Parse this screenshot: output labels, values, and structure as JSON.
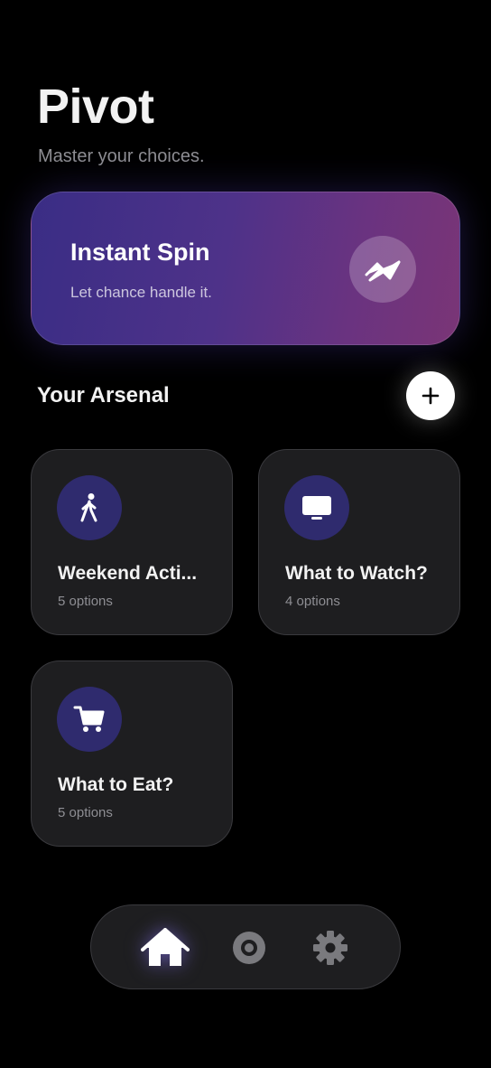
{
  "app": {
    "title": "Pivot",
    "subtitle": "Master your choices."
  },
  "instant_spin": {
    "title": "Instant Spin",
    "subtitle": "Let chance handle it.",
    "icon": "squiggle-wave-icon"
  },
  "arsenal": {
    "title": "Your Arsenal",
    "add_icon": "plus-icon",
    "cards": [
      {
        "title": "Weekend Acti...",
        "count": "5 options",
        "icon": "walking-person-icon"
      },
      {
        "title": "What to Watch?",
        "count": "4 options",
        "icon": "tv-icon"
      },
      {
        "title": "What to Eat?",
        "count": "5 options",
        "icon": "shopping-cart-icon"
      }
    ]
  },
  "tabbar": {
    "items": [
      {
        "name": "home",
        "icon": "home-icon",
        "active": true
      },
      {
        "name": "spin",
        "icon": "target-icon",
        "active": false
      },
      {
        "name": "settings",
        "icon": "gear-icon",
        "active": false
      }
    ]
  },
  "colors": {
    "background": "#000000",
    "card_bg": "#1e1e20",
    "icon_circle": "#2f2b6e",
    "gradient_start": "#3a2d85",
    "gradient_end": "#7a3576",
    "muted_text": "#8e8e93"
  }
}
